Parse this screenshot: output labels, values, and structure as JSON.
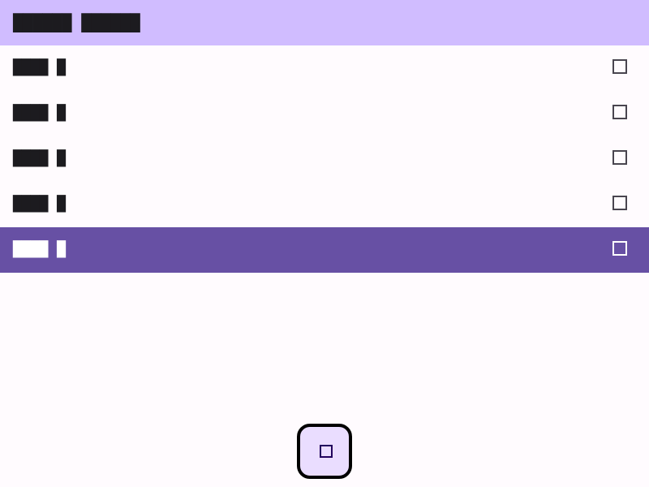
{
  "header": {
    "title": "██████ ██████"
  },
  "list": {
    "items": [
      {
        "label": "████ █",
        "selected": false,
        "icon": "checkbox-icon"
      },
      {
        "label": "████ █",
        "selected": false,
        "icon": "checkbox-icon"
      },
      {
        "label": "████ █",
        "selected": false,
        "icon": "checkbox-icon"
      },
      {
        "label": "████ █",
        "selected": false,
        "icon": "checkbox-icon"
      },
      {
        "label": "████ █",
        "selected": true,
        "icon": "checkbox-icon"
      }
    ]
  },
  "fab": {
    "icon": "square-icon"
  },
  "colors": {
    "header_bg": "#d0bcff",
    "surface": "#fffbfe",
    "selected_bg": "#6750a4",
    "fab_bg": "#eaddff"
  }
}
